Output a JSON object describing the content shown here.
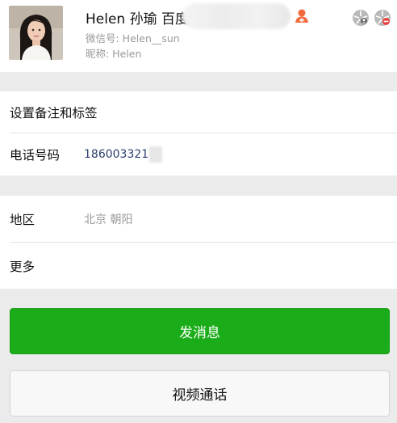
{
  "profile": {
    "name": "Helen 孙瑜 百度",
    "wechat_id": "微信号: Helen__sun",
    "nickname": "昵称: Helen",
    "avatar_icon": "avatar-photo",
    "tag_icon": "star-friend-icon",
    "tag_color": "#f2693c"
  },
  "rows": {
    "set_remark": "设置备注和标签",
    "phone_label": "电话号码",
    "phone_value": "186003321",
    "region_label": "地区",
    "region_value": "北京  朝阳",
    "more_label": "更多"
  },
  "buttons": {
    "send_message": "发消息",
    "video_call": "视频通话"
  },
  "colors": {
    "primary_green": "#1aad19",
    "phone_text": "#2b3f6e",
    "secondary_text": "#9a9a9a"
  }
}
